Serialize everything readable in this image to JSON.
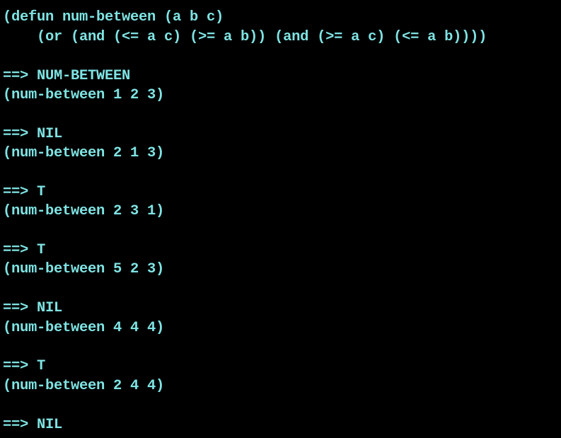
{
  "terminal": {
    "text_color": "#7fe3e3",
    "background": "#000000",
    "lines": [
      "",
      "(defun num-between (a b c)",
      "    (or (and (<= a c) (>= a b)) (and (>= a c) (<= a b))))",
      "",
      "==> NUM-BETWEEN",
      "(num-between 1 2 3)",
      "",
      "==> NIL",
      "(num-between 2 1 3)",
      "",
      "==> T",
      "(num-between 2 3 1)",
      "",
      "==> T",
      "(num-between 5 2 3)",
      "",
      "==> NIL",
      "(num-between 4 4 4)",
      "",
      "==> T",
      "(num-between 2 4 4)",
      "",
      "==> NIL"
    ]
  }
}
